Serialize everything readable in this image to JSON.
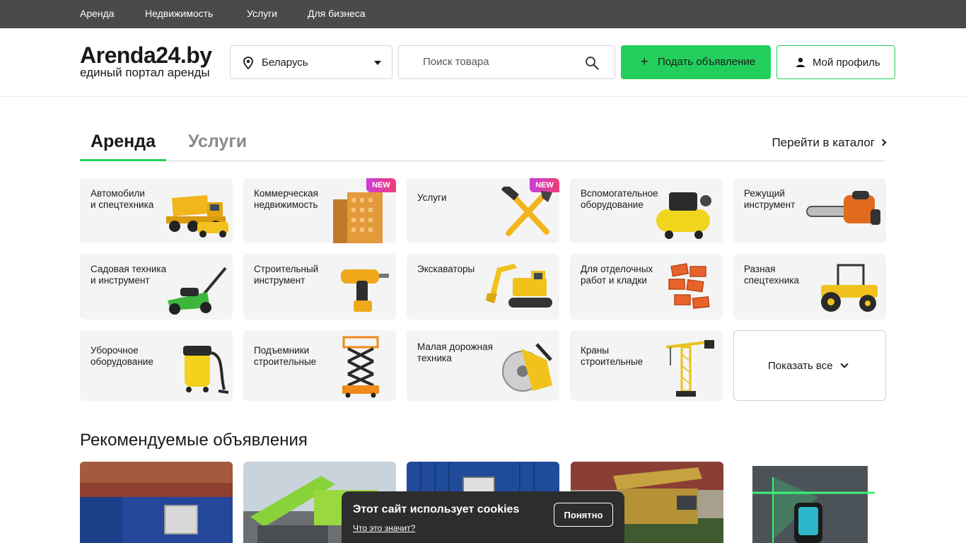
{
  "topnav": {
    "items": [
      "Аренда",
      "Недвижимость",
      "Услуги",
      "Для бизнеса"
    ]
  },
  "header": {
    "logo_title": "Arenda24.by",
    "logo_subtitle": "единый портал аренды",
    "region": "Беларусь",
    "search_placeholder": "Поиск товара",
    "post_button": "Подать объявление",
    "profile_button": "Мой профиль"
  },
  "tabs": {
    "items": [
      "Аренда",
      "Услуги"
    ],
    "active": "Аренда",
    "catalog_link": "Перейти в каталог"
  },
  "categories": [
    {
      "label": "Автомобили\nи спецтехника",
      "icon": "dump-truck-icon"
    },
    {
      "label": "Коммерческая\nнедвижимость",
      "icon": "building-icon",
      "badge": "NEW"
    },
    {
      "label": "Услуги",
      "icon": "tools-icon",
      "badge": "NEW"
    },
    {
      "label": "Вспомогательное\nоборудование",
      "icon": "compressor-icon"
    },
    {
      "label": "Режущий\nинструмент",
      "icon": "chainsaw-icon"
    },
    {
      "label": "Садовая техника\nи инструмент",
      "icon": "lawn-mower-icon"
    },
    {
      "label": "Строительный\nинструмент",
      "icon": "drill-icon"
    },
    {
      "label": "Экскаваторы",
      "icon": "excavator-icon"
    },
    {
      "label": "Для отделочных\nработ и кладки",
      "icon": "bricks-icon"
    },
    {
      "label": "Разная\nспецтехника",
      "icon": "tractor-icon"
    },
    {
      "label": "Уборочное\nоборудование",
      "icon": "vacuum-icon"
    },
    {
      "label": "Подъемники\nстроительные",
      "icon": "scissor-lift-icon"
    },
    {
      "label": "Малая дорожная\nтехника",
      "icon": "cutter-icon"
    },
    {
      "label": "Краны\nстроительные",
      "icon": "crane-icon"
    }
  ],
  "show_all": "Показать все",
  "recommended": {
    "title": "Рекомендуемые объявления",
    "listings": [
      {
        "icon": "container-photo-icon"
      },
      {
        "icon": "truck-crane-photo-icon"
      },
      {
        "icon": "container-photo-icon"
      },
      {
        "icon": "crane-truck-photo-icon"
      },
      {
        "icon": "laser-level-photo-icon"
      }
    ]
  },
  "cookie": {
    "title": "Этот сайт использует cookies",
    "link": "Что это значит?",
    "button": "Понятно"
  },
  "colors": {
    "accent": "#23cf5c",
    "topbar": "#4a4a4a",
    "card_bg": "#f4f4f4",
    "badge_start": "#c83fd8",
    "badge_end": "#ef3d74"
  }
}
